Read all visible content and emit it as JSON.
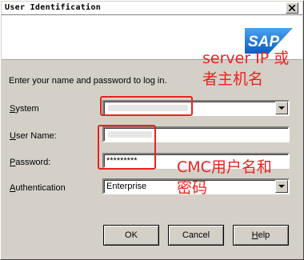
{
  "window": {
    "title": "User Identification"
  },
  "header": {
    "logo_text": "SAP"
  },
  "prompt": "Enter your name and password to log in.",
  "form": {
    "system": {
      "label": "System",
      "value": ""
    },
    "username": {
      "label": "User Name:",
      "value": ""
    },
    "password": {
      "label": "Password:",
      "value": "*********"
    },
    "authentication": {
      "label": "Authentication",
      "value": "Enterprise"
    }
  },
  "buttons": {
    "ok": "OK",
    "cancel": "Cancel",
    "help": "Help"
  },
  "annotations": {
    "server_line1": "server IP 或",
    "server_line2": "者主机名",
    "cmc_line1": "CMC用户名和",
    "cmc_line2": "密码"
  },
  "colors": {
    "annotation": "#e8231f",
    "sap_blue": "#1a6fd1"
  }
}
